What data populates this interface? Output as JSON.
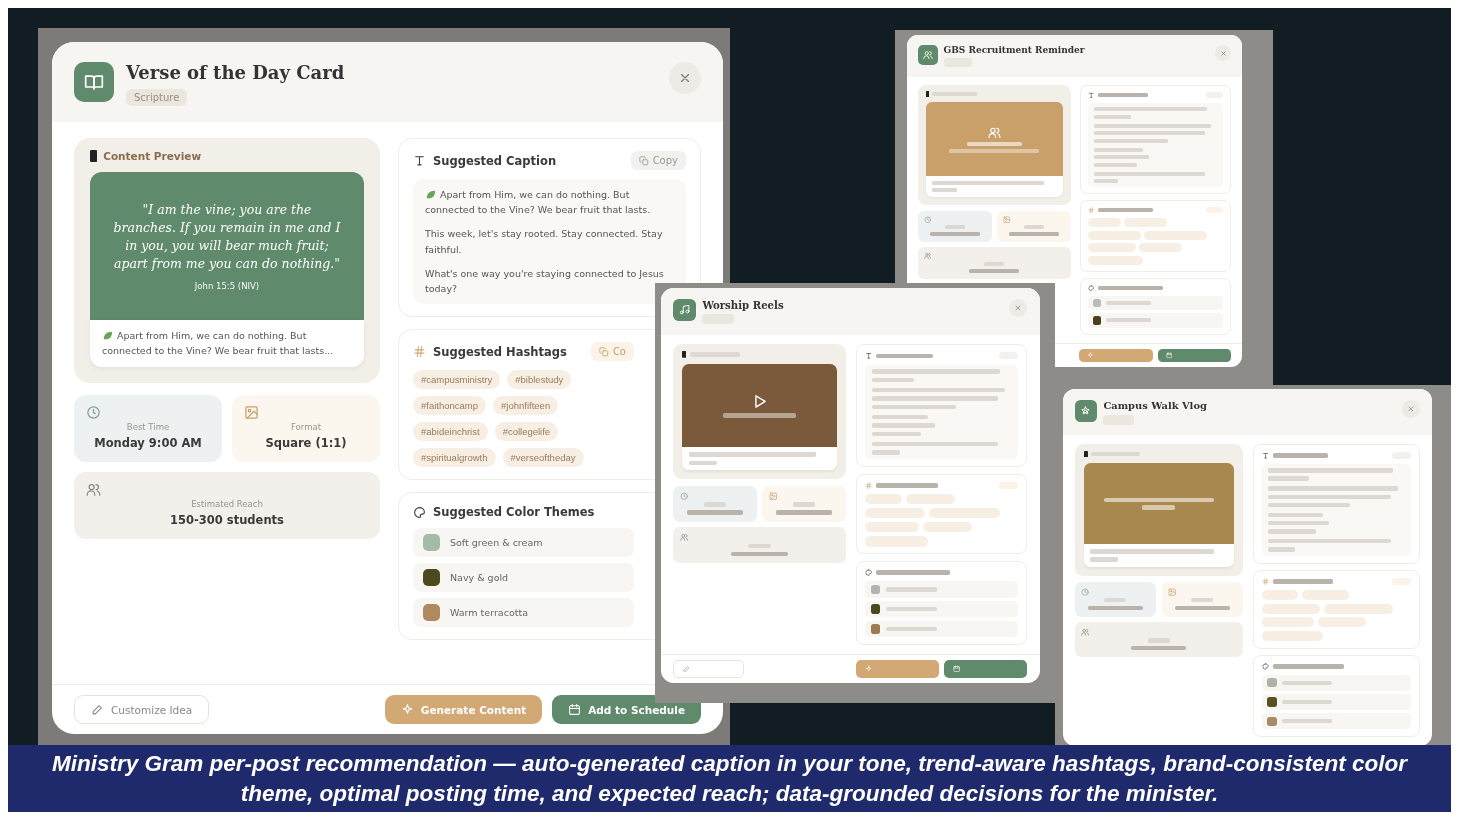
{
  "slide": {
    "windows": [
      {
        "kind": "full",
        "title": "Verse of the Day Card",
        "tag": "Scripture",
        "preview_label": "Content Preview",
        "preview": {
          "kind": "quote",
          "color": "#5f8a6b",
          "quote": "\"I am the vine; you are the branches. If you remain in me and I in you, you will bear much fruit; apart from me you can do nothing.\"",
          "reference": "John 15:5 (NIV)"
        },
        "snippet": {
          "emoji": true,
          "text": "Apart from Him, we can do nothing. But connected to the Vine? We bear fruit that lasts..."
        },
        "stats": [
          {
            "label": "Best Time",
            "value": "Monday 9:00 AM"
          },
          {
            "label": "Format",
            "value": "Square (1:1)"
          },
          {
            "label": "Estimated Reach",
            "value": "150-300 students"
          }
        ],
        "caption": {
          "title": "Suggested Caption",
          "copy": "Copy",
          "paragraphs": [
            {
              "emoji": true,
              "text": "Apart from Him, we can do nothing. But connected to the Vine? We bear fruit that lasts."
            },
            {
              "emoji": false,
              "text": "This week, let's stay rooted. Stay connected. Stay faithful."
            },
            {
              "emoji": false,
              "text": "What's one way you're staying connected to Jesus today?"
            }
          ]
        },
        "hashtags": {
          "title": "Suggested Hashtags",
          "copy": "Co",
          "tags": [
            "#campusministry",
            "#biblestudy",
            "#faithoncamp",
            "#johnfifteen",
            "#abideinchrist",
            "#collegelife",
            "#spiritualgrowth",
            "#verseoftheday"
          ]
        },
        "themes": {
          "title": "Suggested Color Themes",
          "items": [
            {
              "name": "Soft green & cream",
              "color": "#a3bba9"
            },
            {
              "name": "Navy & gold",
              "color": "#4a4a1e"
            },
            {
              "name": "Warm terracotta",
              "color": "#b08a5e"
            }
          ]
        },
        "buttons": [
          {
            "kind": "outline",
            "label": "Customize Idea"
          },
          {
            "kind": "accent",
            "label": "Generate Content"
          },
          {
            "kind": "primary",
            "label": "Add to Schedule"
          }
        ]
      },
      {
        "kind": "thumbnail",
        "title": "GBS Recruitment Reminder",
        "preview": {
          "kind": "event",
          "color": "#c9a06a"
        },
        "themes": [
          {
            "color": "#b9bdb5"
          },
          {
            "color": "#4c3f1c"
          }
        ]
      },
      {
        "kind": "thumbnail",
        "title": "Worship Reels",
        "preview": {
          "kind": "video",
          "color": "#7a5a3a"
        },
        "themes": [
          {
            "color": "#b4b4ae"
          },
          {
            "color": "#4a4a1c"
          },
          {
            "color": "#9c7a52"
          }
        ]
      },
      {
        "kind": "thumbnail",
        "title": "Campus Walk Vlog",
        "preview": {
          "kind": "quote",
          "color": "#a8884f"
        },
        "themes": [
          {
            "color": "#aab2a8"
          },
          {
            "color": "#5a5020"
          },
          {
            "color": "#a88a66"
          }
        ]
      }
    ],
    "caption": "Ministry Gram per-post recommendation — auto-generated caption in your tone, trend-aware hashtags, brand-consistent color theme, optimal posting time, and expected reach; data-grounded decisions for the minister."
  }
}
